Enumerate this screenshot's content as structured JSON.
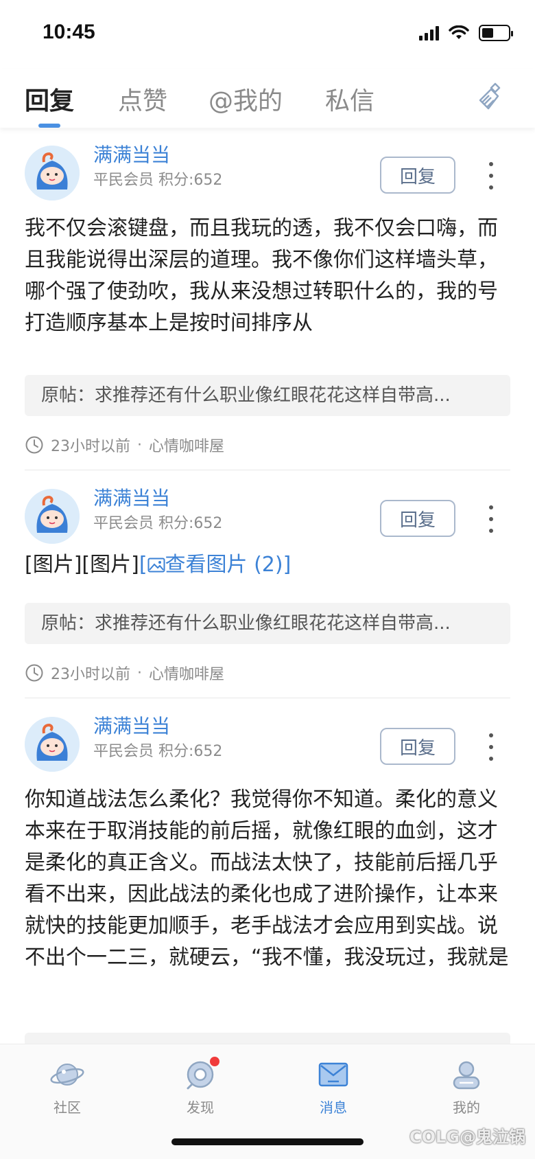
{
  "status": {
    "time": "10:45"
  },
  "tabs": [
    {
      "label": "回复",
      "active": true
    },
    {
      "label": "点赞",
      "active": false
    },
    {
      "label": "@我的",
      "active": false
    },
    {
      "label": "私信",
      "active": false
    }
  ],
  "items": [
    {
      "username": "满满当当",
      "rank": "平民会员",
      "score": "积分:652",
      "reply_label": "回复",
      "content": "我不仅会滚键盘，而且我玩的透，我不仅会口嗨，而且我能说得出深层的道理。我不像你们这样墙头草，哪个强了使劲吹，我从来没想过转职什么的，我的号打造顺序基本上是按时间排序从",
      "quote": "原帖：求推荐还有什么职业像红眼花花这样自带高...",
      "time": "23小时以前",
      "dot": "·",
      "board": "心情咖啡屋"
    },
    {
      "username": "满满当当",
      "rank": "平民会员",
      "score": "积分:652",
      "reply_label": "回复",
      "content_plain": "[图片][图片]",
      "content_link": "[",
      "link_text": "查看图片 (2)]",
      "quote": "原帖：求推荐还有什么职业像红眼花花这样自带高...",
      "time": "23小时以前",
      "dot": "·",
      "board": "心情咖啡屋"
    },
    {
      "username": "满满当当",
      "rank": "平民会员",
      "score": "积分:652",
      "reply_label": "回复",
      "content": "你知道战法怎么柔化？我觉得你不知道。柔化的意义本来在于取消技能的前后摇，就像红眼的血剑，这才是柔化的真正含义。而战法太快了，技能前后摇几乎看不出来，因此战法的柔化也成了进阶操作，让本来就快的技能更加顺手，老手战法才会应用到实战。说不出个一二三，就硬云，“我不懂，我没玩过，我就是觉得我觉得的强无"
    }
  ],
  "nav": [
    {
      "label": "社区",
      "icon": "planet-icon",
      "active": false
    },
    {
      "label": "发现",
      "icon": "discover-icon",
      "active": false,
      "badge": true
    },
    {
      "label": "消息",
      "icon": "mail-icon",
      "active": true
    },
    {
      "label": "我的",
      "icon": "profile-icon",
      "active": false
    }
  ],
  "watermark": "COLG@鬼泣锅",
  "colors": {
    "accent": "#3c82d6",
    "badge": "#f03b3b"
  }
}
